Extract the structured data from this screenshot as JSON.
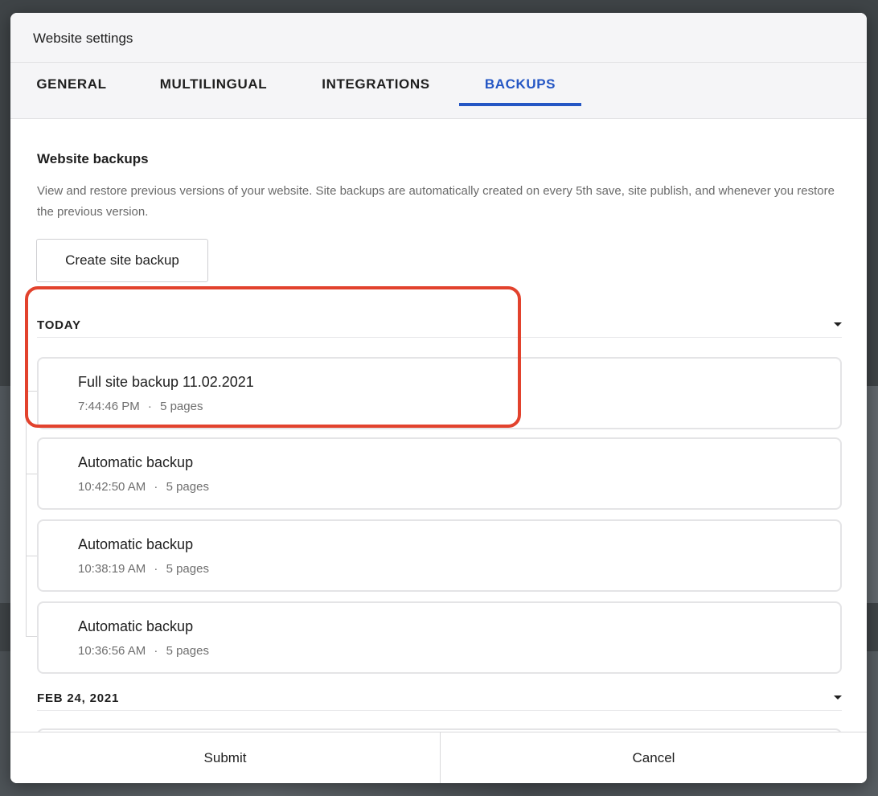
{
  "dialog": {
    "title": "Website settings"
  },
  "tabs": [
    {
      "label": "GENERAL",
      "active": false
    },
    {
      "label": "MULTILINGUAL",
      "active": false
    },
    {
      "label": "INTEGRATIONS",
      "active": false
    },
    {
      "label": "BACKUPS",
      "active": true
    }
  ],
  "backups": {
    "title": "Website backups",
    "description": "View and restore previous versions of your website. Site backups are automatically created on every 5th save, site publish, and whenever you restore the previous version.",
    "create_button": "Create site backup",
    "groups": [
      {
        "label": "TODAY",
        "items": [
          {
            "title": "Full site backup 11.02.2021",
            "time": "7:44:46 PM",
            "pages": "5 pages"
          },
          {
            "title": "Automatic backup",
            "time": "10:42:50 AM",
            "pages": "5 pages"
          },
          {
            "title": "Automatic backup",
            "time": "10:38:19 AM",
            "pages": "5 pages"
          },
          {
            "title": "Automatic backup",
            "time": "10:36:56 AM",
            "pages": "5 pages"
          }
        ]
      },
      {
        "label": "FEB 24, 2021",
        "items": []
      }
    ],
    "meta_separator": "·"
  },
  "footer": {
    "submit": "Submit",
    "cancel": "Cancel"
  },
  "colors": {
    "accent": "#2456c4",
    "highlight": "#e2422d"
  },
  "icons": {
    "group_toggle": "caret-down-icon"
  }
}
